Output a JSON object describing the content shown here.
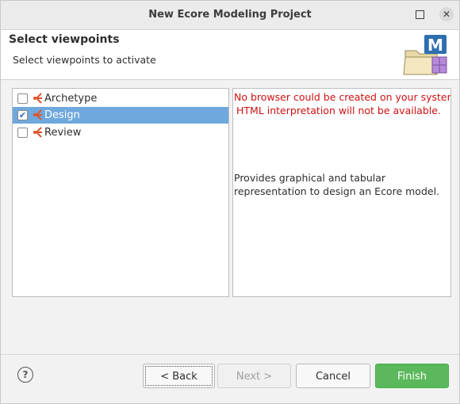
{
  "window": {
    "title": "New Ecore Modeling Project"
  },
  "header": {
    "title": "Select viewpoints",
    "subtitle": "Select viewpoints to activate"
  },
  "viewpoints": [
    {
      "label": "Archetype",
      "checked": false,
      "selected": false
    },
    {
      "label": "Design",
      "checked": true,
      "selected": true
    },
    {
      "label": "Review",
      "checked": false,
      "selected": false
    }
  ],
  "description": {
    "error_line1": "No browser could be created on your system.",
    "error_line2": "HTML interpretation will not be available.",
    "text_line1": "Provides graphical and tabular",
    "text_line2": "representation to design an Ecore model."
  },
  "buttons": {
    "help": "?",
    "back": "< Back",
    "next": "Next >",
    "cancel": "Cancel",
    "finish": "Finish"
  },
  "colors": {
    "selection": "#6fa8dc",
    "error": "#d01010",
    "finish": "#5cb85c",
    "icon_orange": "#e0552a"
  }
}
